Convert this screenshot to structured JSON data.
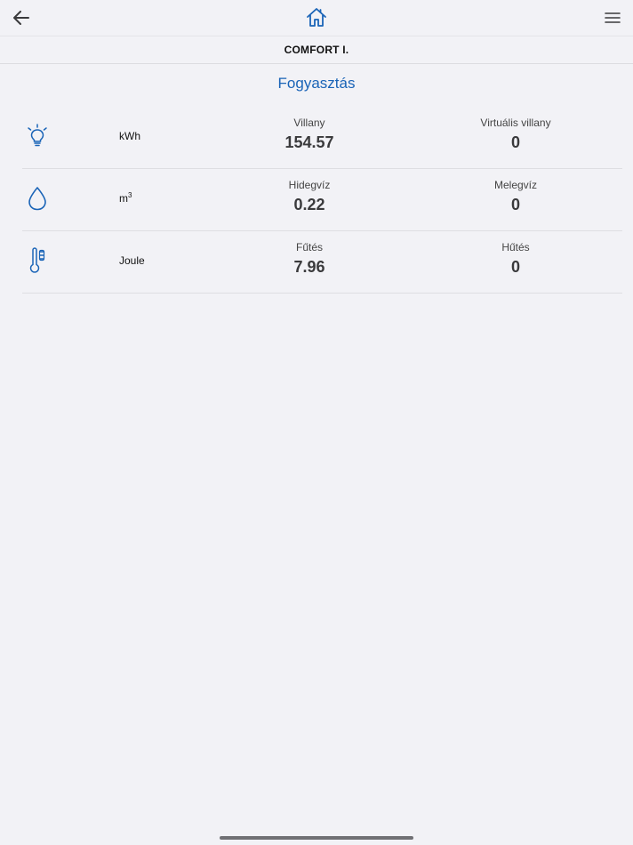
{
  "nav": {
    "back_icon": "arrow-left-icon",
    "home_icon": "house-icon",
    "menu_icon": "hamburger-menu-icon"
  },
  "subheader": {
    "title": "COMFORT I."
  },
  "section": {
    "title": "Fogyasztás"
  },
  "rows": [
    {
      "icon": "lightbulb-icon",
      "unit": "kWh",
      "metrics": [
        {
          "label": "Villany",
          "value": "154.57"
        },
        {
          "label": "Virtuális villany",
          "value": "0"
        }
      ]
    },
    {
      "icon": "water-drop-icon",
      "unit": "m",
      "unit_superscript": "3",
      "metrics": [
        {
          "label": "Hidegvíz",
          "value": "0.22"
        },
        {
          "label": "Melegvíz",
          "value": "0"
        }
      ]
    },
    {
      "icon": "thermometer-icon",
      "unit": "Joule",
      "metrics": [
        {
          "label": "Fűtés",
          "value": "7.96"
        },
        {
          "label": "Hűtés",
          "value": "0"
        }
      ]
    }
  ],
  "colors": {
    "accent": "#1a64b7",
    "background": "#f2f2f6",
    "divider": "#dedee2"
  }
}
